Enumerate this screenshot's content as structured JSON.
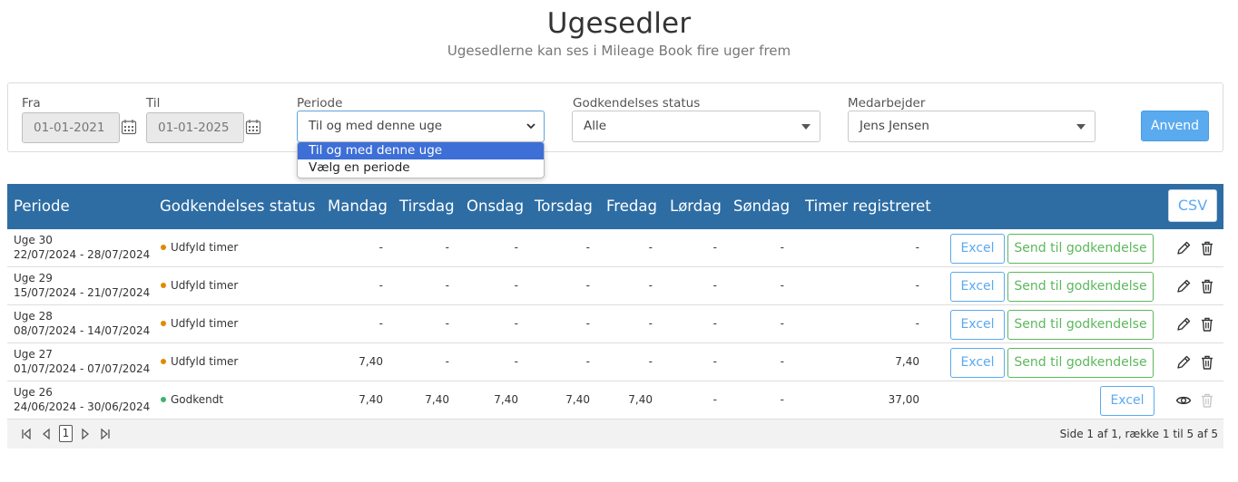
{
  "header": {
    "title": "Ugesedler",
    "subtitle": "Ugesedlerne kan ses i Mileage Book fire uger frem"
  },
  "filters": {
    "from_label": "Fra",
    "from_value": "01-01-2021",
    "to_label": "Til",
    "to_value": "01-01-2025",
    "period_label": "Periode",
    "period_value": "Til og med denne uge",
    "period_options": [
      "Til og med denne uge",
      "Vælg en periode"
    ],
    "status_label": "Godkendelses status",
    "status_value": "Alle",
    "employee_label": "Medarbejder",
    "employee_value": "Jens Jensen",
    "apply_label": "Anvend"
  },
  "table": {
    "columns": [
      "Periode",
      "Godkendelses status",
      "Mandag",
      "Tirsdag",
      "Onsdag",
      "Torsdag",
      "Fredag",
      "Lørdag",
      "Søndag",
      "Timer registreret"
    ],
    "csv_label": "CSV",
    "excel_label": "Excel",
    "send_label": "Send til godkendelse",
    "rows": [
      {
        "week": "Uge 30",
        "dates": "22/07/2024 - 28/07/2024",
        "status": "Udfyld timer",
        "status_color": "#e08a00",
        "days": [
          "-",
          "-",
          "-",
          "-",
          "-",
          "-",
          "-"
        ],
        "total": "-",
        "send": true
      },
      {
        "week": "Uge 29",
        "dates": "15/07/2024 - 21/07/2024",
        "status": "Udfyld timer",
        "status_color": "#e08a00",
        "days": [
          "-",
          "-",
          "-",
          "-",
          "-",
          "-",
          "-"
        ],
        "total": "-",
        "send": true
      },
      {
        "week": "Uge 28",
        "dates": "08/07/2024 - 14/07/2024",
        "status": "Udfyld timer",
        "status_color": "#e08a00",
        "days": [
          "-",
          "-",
          "-",
          "-",
          "-",
          "-",
          "-"
        ],
        "total": "-",
        "send": true
      },
      {
        "week": "Uge 27",
        "dates": "01/07/2024 - 07/07/2024",
        "status": "Udfyld timer",
        "status_color": "#e08a00",
        "days": [
          "7,40",
          "-",
          "-",
          "-",
          "-",
          "-",
          "-"
        ],
        "total": "7,40",
        "send": true
      },
      {
        "week": "Uge 26",
        "dates": "24/06/2024 - 30/06/2024",
        "status": "Godkendt",
        "status_color": "#3cb371",
        "days": [
          "7,40",
          "7,40",
          "7,40",
          "7,40",
          "7,40",
          "-",
          "-"
        ],
        "total": "37,00",
        "send": false
      }
    ]
  },
  "pager": {
    "current_page": "1",
    "info": "Side 1 af 1, række 1 til 5 af 5"
  },
  "colors": {
    "header_bg": "#2e6da4",
    "primary": "#5aaaf0",
    "success": "#5cb85c",
    "dropdown_selected": "#3d6fd6"
  }
}
